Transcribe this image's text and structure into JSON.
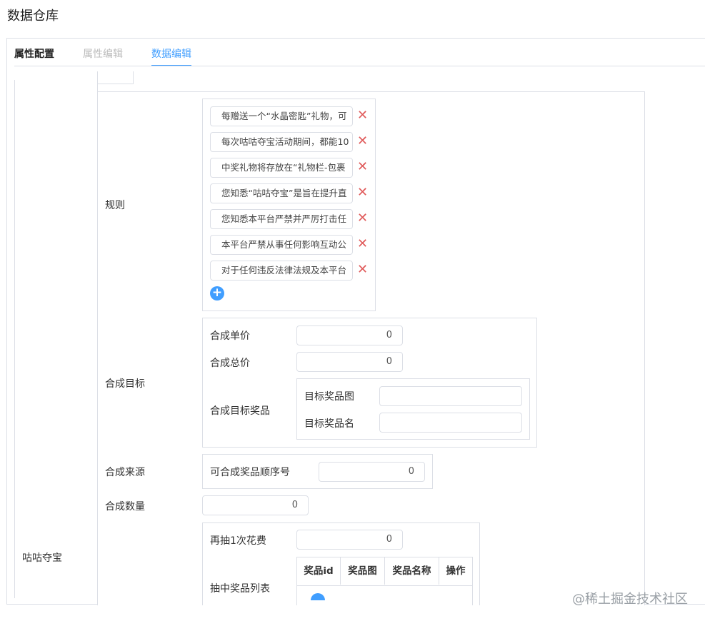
{
  "page_title": "数据仓库",
  "tabs": [
    {
      "label": "属性配置",
      "state": "active"
    },
    {
      "label": "属性编辑",
      "state": "disabled"
    },
    {
      "label": "数据编辑",
      "state": "selected"
    }
  ],
  "section_label": "咕咕夺宝",
  "rules": {
    "label": "规则",
    "items": [
      "每赠送一个“水晶密匙”礼物，可",
      "每次咕咕夺宝活动期间，都能10",
      "中奖礼物将存放在“礼物栏-包裹",
      "您知悉“咕咕夺宝”是旨在提升直",
      "您知悉本平台严禁并严厉打击任",
      "本平台严禁从事任何影响互动公",
      "对于任何违反法律法规及本平台"
    ]
  },
  "synthesis_target": {
    "label": "合成目标",
    "unit_price_label": "合成单价",
    "unit_price_value": "0",
    "total_price_label": "合成总价",
    "total_price_value": "0",
    "prize_label": "合成目标奖品",
    "prize_image_label": "目标奖品图",
    "prize_name_label": "目标奖品名"
  },
  "synthesis_source": {
    "label": "合成来源",
    "order_label": "可合成奖品顺序号",
    "order_value": "0"
  },
  "synthesis_count": {
    "label": "合成数量",
    "value": "0"
  },
  "redraw": {
    "cost_label": "再抽1次花费",
    "cost_value": "0",
    "list_label": "抽中奖品列表",
    "columns": [
      "奖品id",
      "奖品图",
      "奖品名称",
      "操作"
    ]
  },
  "watermark": "@稀土掘金技术社区",
  "colors": {
    "accent": "#409eff",
    "delete": "#e05a5a",
    "border": "#dcdfe6"
  }
}
